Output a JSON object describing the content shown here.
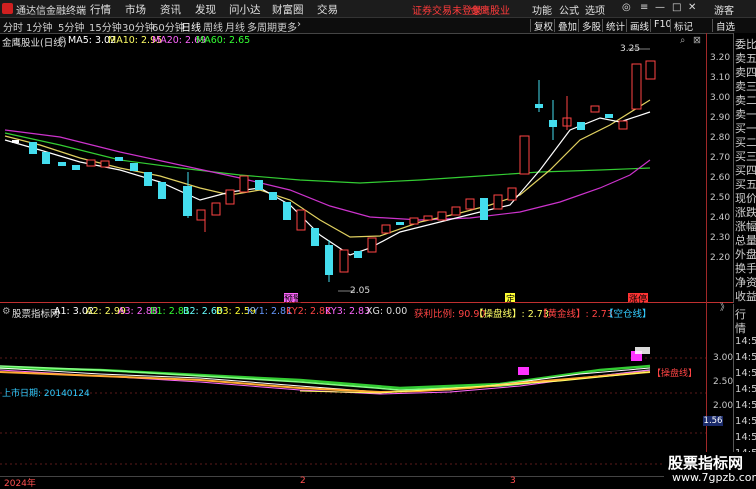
{
  "titlebar": {
    "app_name": "通达信金融终端",
    "menus": [
      "行情",
      "市场",
      "资讯",
      "发现",
      "问小达",
      "财富圈",
      "交易"
    ],
    "login_notice": "证券交易未登录",
    "account": "金鹰股业",
    "right_menus": [
      "功能",
      "公式",
      "选项"
    ],
    "guest": "游客"
  },
  "toolbar": {
    "periods": [
      "分时",
      "1分钟",
      "5分钟",
      "15分钟",
      "30分钟",
      "60分钟",
      "日线",
      "周线",
      "月线",
      "多周期",
      "更多"
    ],
    "selected": "日线",
    "right_buttons": [
      "复权",
      "叠加",
      "多股",
      "统计",
      "画线",
      "F10",
      "标记",
      "自选"
    ]
  },
  "main_chart": {
    "stock_label": "金鹰股业(日线)",
    "ma": [
      {
        "label": "MA5:",
        "value": "3.02",
        "color": "#ffffff"
      },
      {
        "label": "MA10:",
        "value": "2.95",
        "color": "#ffff66"
      },
      {
        "label": "MA20:",
        "value": "2.69",
        "color": "#ff66ff"
      },
      {
        "label": "MA60:",
        "value": "2.65",
        "color": "#33ff33"
      }
    ],
    "y_ticks": [
      "3.20",
      "3.10",
      "3.00",
      "2.90",
      "2.80",
      "2.70",
      "2.60",
      "2.50",
      "2.40",
      "2.30",
      "2.20"
    ],
    "high_label": "3.25",
    "low_label": "2.05",
    "signals": [
      {
        "text": "预警",
        "color": "#ff66ff"
      },
      {
        "text": "定",
        "color": "#ffff33"
      },
      {
        "text": "涨停",
        "color": "#ff3333"
      }
    ],
    "icons": [
      "search-icon",
      "close-icon"
    ]
  },
  "right_panel": {
    "items": [
      "委比",
      "卖五",
      "卖四",
      "卖三",
      "卖二",
      "卖一",
      "买一",
      "买二",
      "买三",
      "买四",
      "买五",
      "现价",
      "涨跌",
      "涨幅",
      "总量",
      "外盘",
      "换手",
      "净资",
      "收益"
    ],
    "lower_items": [
      "行",
      "情",
      "14:5",
      "14:5",
      "14:5",
      "14:5",
      "14:5",
      "14:5",
      "14:5",
      "14:5"
    ]
  },
  "indicator": {
    "name": "股票指标网",
    "values": [
      {
        "text": "A1: 3.02",
        "color": "#ffffff"
      },
      {
        "text": "A2: 2.99",
        "color": "#ffff66"
      },
      {
        "text": "A3: 2.88",
        "color": "#ff66ff"
      },
      {
        "text": "B1: 2.81",
        "color": "#33ff33"
      },
      {
        "text": "B2: 2.60",
        "color": "#66ffff"
      },
      {
        "text": "B3: 2.59",
        "color": "#ffff33"
      },
      {
        "text": "KY1: 2.81",
        "color": "#6699ff"
      },
      {
        "text": "KY2: 2.82",
        "color": "#ff4444"
      },
      {
        "text": "KY3: 2.83",
        "color": "#ff66ff"
      },
      {
        "text": "XG: 0.00",
        "color": "#dddddd"
      },
      {
        "text": "获利比例: 90.90",
        "color": "#ff4444"
      },
      {
        "text": "【操盘线】: 2.73",
        "color": "#ffff66"
      },
      {
        "text": "【黄金线】: 2.73",
        "color": "#ff4444"
      },
      {
        "text": "【空仓线】",
        "color": "#33ccff"
      }
    ],
    "y_ticks": [
      "3.00",
      "2.50",
      "2.00"
    ],
    "listing_date": "上市日期: 20140124",
    "inline_label": "【操盘线】",
    "value_tag": "1.56",
    "chevron": "》"
  },
  "x_axis": {
    "labels": [
      "2024年",
      "2",
      "3"
    ]
  },
  "watermark": {
    "title": "股票指标网",
    "url": "www.7gpzb.com"
  }
}
